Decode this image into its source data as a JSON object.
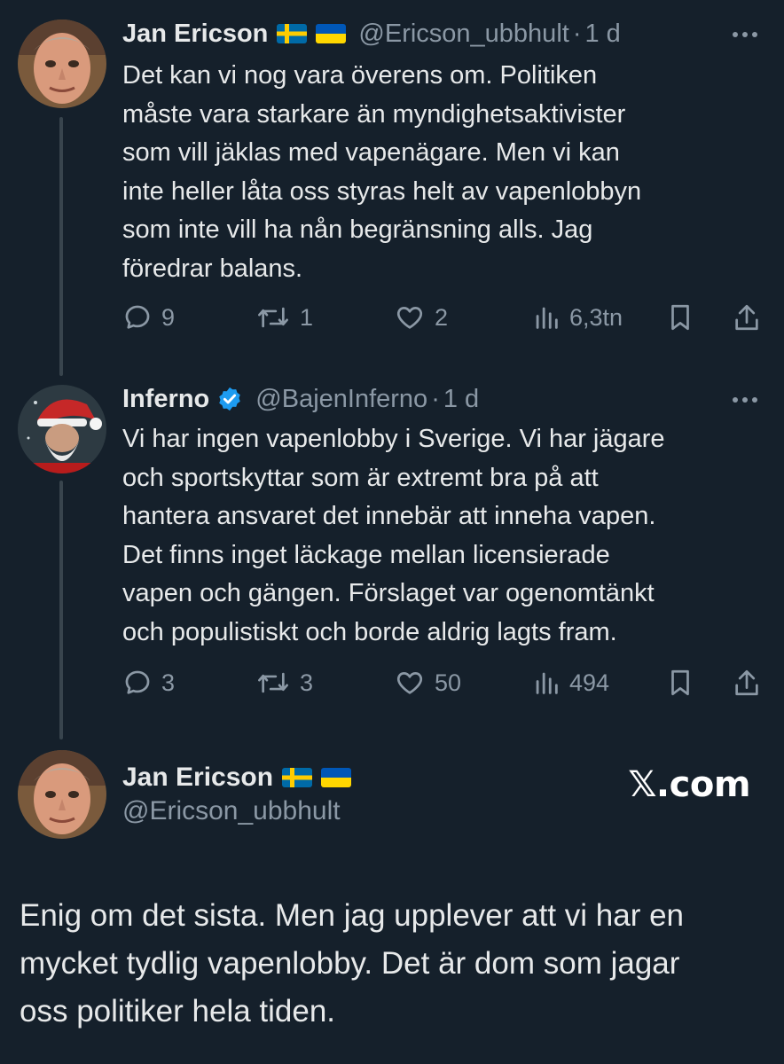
{
  "tweets": [
    {
      "name": "Jan Ericson",
      "handle": "@Ericson_ubbhult",
      "dot": "·",
      "time": "1 d",
      "lines": [
        "Det kan vi nog vara överens om. Politiken",
        "måste vara starkare än myndighetsaktivister",
        "som vill jäklas med vapenägare. Men vi kan",
        "inte heller låta oss styras helt av vapenlobbyn",
        "som inte vill ha nån begränsning alls. Jag",
        "föredrar balans."
      ],
      "replies": "9",
      "retweets": "1",
      "likes": "2",
      "views": "6,3tn"
    },
    {
      "name": "Inferno",
      "handle": "@BajenInferno",
      "dot": "·",
      "time": "1 d",
      "lines": [
        "Vi har ingen vapenlobby i Sverige. Vi har jägare",
        "och sportskyttar som är extremt bra på att",
        "hantera ansvaret det innebär att inneha vapen.",
        "Det finns inget läckage mellan licensierade",
        "vapen och gängen. Förslaget var ogenomtänkt",
        "och populistiskt och borde aldrig lagts fram."
      ],
      "replies": "3",
      "retweets": "3",
      "likes": "50",
      "views": "494"
    }
  ],
  "quote": {
    "name": "Jan Ericson",
    "handle": "@Ericson_ubbhult",
    "brand": "𝕏.com",
    "lines": [
      "Enig om det sista. Men jag upplever att vi har en",
      "mycket tydlig vapenlobby. Det är dom som jagar",
      "oss politiker hela tiden."
    ]
  },
  "colors": {
    "background": "#15202b",
    "text": "#e7e9ea",
    "muted": "#8b98a5",
    "verified": "#1d9bf0",
    "thread_line": "#38444d"
  },
  "icons": [
    "reply-icon",
    "retweet-icon",
    "like-icon",
    "views-icon",
    "bookmark-icon",
    "share-icon",
    "more-icon",
    "verified-badge-icon",
    "sweden-flag-icon",
    "ukraine-flag-icon"
  ]
}
